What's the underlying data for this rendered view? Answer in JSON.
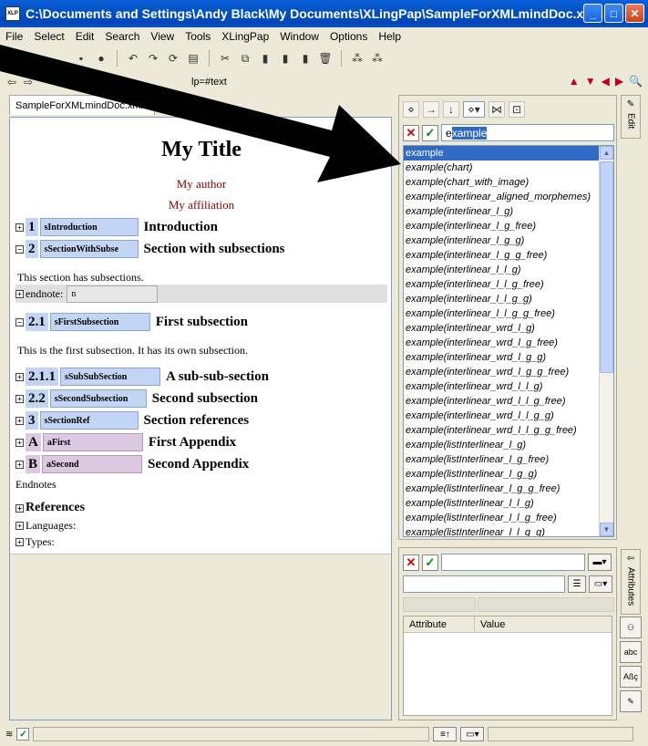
{
  "window": {
    "title": "C:\\Documents and Settings\\Andy Black\\My Documents\\XLingPap\\SampleForXMLmindDoc.xml",
    "app_icon": "XLP",
    "minimize_icon": "_",
    "maximize_icon": "□",
    "close_icon": "✕"
  },
  "menu": [
    "File",
    "Select",
    "Edit",
    "Search",
    "View",
    "Tools",
    "XLingPap",
    "Window",
    "Options",
    "Help"
  ],
  "toolbar": {
    "path_text": "lp=#text"
  },
  "editor_tab": {
    "label": "SampleForXMLmindDoc.xml",
    "close_icon": "✕"
  },
  "document": {
    "title": "My Title",
    "author": "My author",
    "affiliation": "My affiliation",
    "sections": [
      {
        "num": "1",
        "id": "sIntroduction",
        "title": "Introduction",
        "expand": "+"
      },
      {
        "num": "2",
        "id": "sSectionWithSubse",
        "title": "Section with subsections",
        "expand": "−"
      },
      {
        "num": "2.1",
        "id": "sFirstSubsection",
        "title": "First subsection",
        "expand": "−"
      },
      {
        "num": "2.1.1",
        "id": "sSubSubSection",
        "title": "A sub-sub-section",
        "expand": "+"
      },
      {
        "num": "2.2",
        "id": "sSecondSubsection",
        "title": "Second subsection",
        "expand": "+"
      },
      {
        "num": "3",
        "id": "sSectionRef",
        "title": "Section references",
        "expand": "+"
      },
      {
        "num": "A",
        "id": "aFirst",
        "title": "First Appendix",
        "expand": "+"
      },
      {
        "num": "B",
        "id": "aSecond",
        "title": "Second Appendix",
        "expand": "+"
      }
    ],
    "section2_text": "This section has subsections.",
    "endnote_label": "endnote:",
    "endnote_value": "n",
    "subsection_text": "This is the first subsection. It has its own subsection.",
    "endnotes_label": "Endnotes",
    "references_label": "References",
    "languages_label": "Languages:",
    "types_label": "Types:",
    "expand_plus": "+"
  },
  "element_panel": {
    "input_prefix": "e",
    "input_selected": "xample",
    "cancel_icon": "✕",
    "ok_icon": "✓",
    "items": [
      "example",
      "example(chart)",
      "example(chart_with_image)",
      "example(interlinear_aligned_morphemes)",
      "example(interlinear_l_g)",
      "example(interlinear_l_g_free)",
      "example(interlinear_l_g_g)",
      "example(interlinear_l_g_g_free)",
      "example(interlinear_l_l_g)",
      "example(interlinear_l_l_g_free)",
      "example(interlinear_l_l_g_g)",
      "example(interlinear_l_l_g_g_free)",
      "example(interlinear_wrd_l_g)",
      "example(interlinear_wrd_l_g_free)",
      "example(interlinear_wrd_l_g_g)",
      "example(interlinear_wrd_l_g_g_free)",
      "example(interlinear_wrd_l_l_g)",
      "example(interlinear_wrd_l_l_g_free)",
      "example(interlinear_wrd_l_l_g_g)",
      "example(interlinear_wrd_l_l_g_g_free)",
      "example(listInterlinear_l_g)",
      "example(listInterlinear_l_g_free)",
      "example(listInterlinear_l_g_g)",
      "example(listInterlinear_l_g_g_free)",
      "example(listInterlinear_l_l_g)",
      "example(listInterlinear_l_l_g_free)",
      "example(listInterlinear_l_l_g_g)"
    ],
    "side_tab": "Edit"
  },
  "attribute_panel": {
    "columns": [
      "Attribute",
      "Value"
    ],
    "side_tab": "Attributes"
  },
  "side_buttons": [
    "abc",
    "Aßç"
  ],
  "colors": {
    "title_bar": "#0453c5",
    "section_id_bg": "#c3d5f5",
    "appendix_id_bg": "#dcc8e0",
    "author_color": "#8b0000",
    "list_selection": "#316ac5"
  }
}
